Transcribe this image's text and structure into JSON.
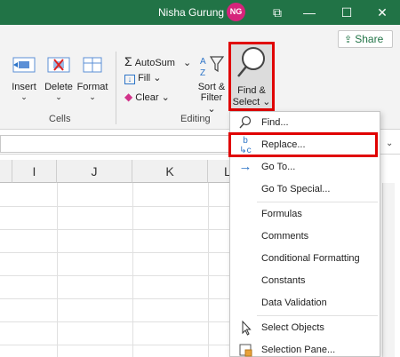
{
  "titlebar": {
    "user_name": "Nisha Gurung",
    "avatar_initials": "NG",
    "minimize": "—",
    "restore": "☐",
    "close": "✕"
  },
  "ribbon": {
    "share_label": "Share",
    "cells": {
      "group_label": "Cells",
      "insert": "Insert",
      "delete": "Delete",
      "format": "Format"
    },
    "editing": {
      "group_label": "Editing",
      "autosum": "AutoSum",
      "fill": "Fill",
      "clear": "Clear",
      "sort_filter_line1": "Sort &",
      "sort_filter_line2": "Filter",
      "find_select_line1": "Find &",
      "find_select_line2": "Select"
    }
  },
  "grid": {
    "columns": [
      "I",
      "J",
      "K",
      "L"
    ]
  },
  "menu": {
    "items": [
      {
        "label": "Find...",
        "icon": "magnifier-icon"
      },
      {
        "label": "Replace...",
        "icon": "replace-icon"
      },
      {
        "label": "Go To...",
        "icon": "arrow-right-icon"
      },
      {
        "label": "Go To Special..."
      },
      {
        "label": "Formulas"
      },
      {
        "label": "Comments"
      },
      {
        "label": "Conditional Formatting"
      },
      {
        "label": "Constants"
      },
      {
        "label": "Data Validation"
      },
      {
        "label": "Select Objects",
        "icon": "cursor-icon"
      },
      {
        "label": "Selection Pane...",
        "icon": "selection-pane-icon"
      }
    ]
  },
  "colors": {
    "excel_green": "#217346",
    "highlight_red": "#e00000",
    "avatar": "#d6247b"
  }
}
